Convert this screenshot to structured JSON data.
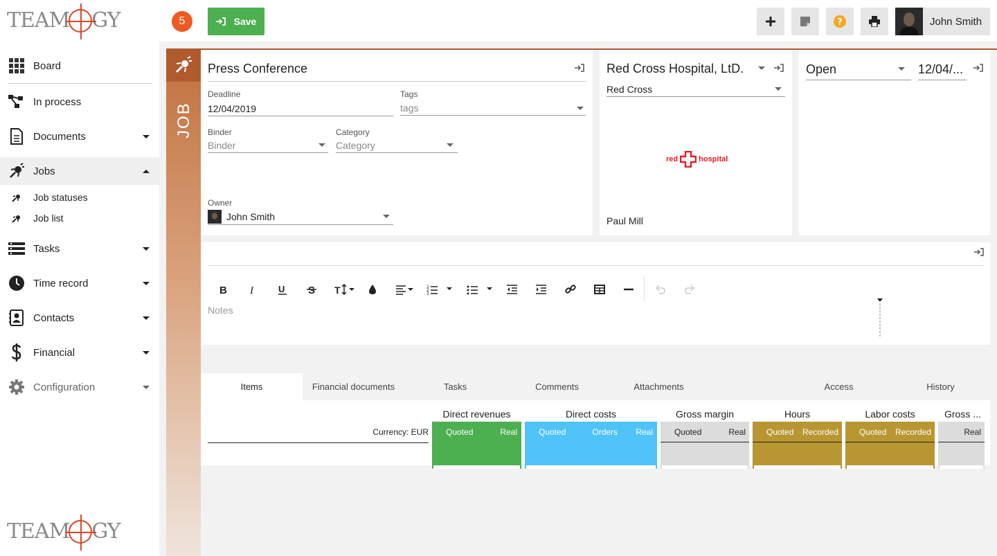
{
  "app": {
    "logo_text_left": "TEAM",
    "logo_text_right": "GY"
  },
  "sidebar": {
    "items": [
      {
        "label": "Board",
        "icon": "grid-icon"
      },
      {
        "label": "In process",
        "icon": "workflow-icon"
      },
      {
        "label": "Documents",
        "icon": "document-icon"
      },
      {
        "label": "Jobs",
        "icon": "rocket-icon"
      },
      {
        "label": "Job statuses",
        "icon": "rocket-icon"
      },
      {
        "label": "Job list",
        "icon": "rocket-icon"
      },
      {
        "label": "Tasks",
        "icon": "tasks-icon"
      },
      {
        "label": "Time record",
        "icon": "clock-icon"
      },
      {
        "label": "Contacts",
        "icon": "contacts-icon"
      },
      {
        "label": "Financial",
        "icon": "dollar-icon"
      },
      {
        "label": "Configuration",
        "icon": "gear-icon"
      }
    ]
  },
  "header": {
    "badge_count": "5",
    "save_label": "Save",
    "user_name": "John Smith"
  },
  "job": {
    "strip_label": "JOB",
    "title": "Press Conference",
    "deadline_label": "Deadline",
    "deadline_value": "12/04/2019",
    "tags_label": "Tags",
    "tags_placeholder": "tags",
    "binder_label": "Binder",
    "binder_placeholder": "Binder",
    "category_label": "Category",
    "category_placeholder": "Category",
    "owner_label": "Owner",
    "owner_value": "John Smith"
  },
  "client": {
    "company": "Red Cross Hospital, LtD.",
    "contact_group": "Red Cross",
    "logo_left": "red",
    "logo_right": "hospital",
    "person": "Paul Mill"
  },
  "status": {
    "value": "Open",
    "date": "12/04/..."
  },
  "notes": {
    "placeholder": "Notes"
  },
  "tabs": [
    "Items",
    "Financial documents",
    "Tasks",
    "Comments",
    "Attachments",
    "Access",
    "History"
  ],
  "items_grid": {
    "currency": "Currency: EUR",
    "groups": [
      {
        "title": "Direct revenues",
        "cols": [
          "Quoted",
          "Real"
        ],
        "color": "#4caf50"
      },
      {
        "title": "Direct costs",
        "cols": [
          "Quoted",
          "Orders",
          "Real"
        ],
        "color": "#4fc3f7"
      },
      {
        "title": "Gross margin",
        "cols": [
          "Quoted",
          "Real"
        ],
        "color": "#dcdcdc"
      },
      {
        "title": "Hours",
        "cols": [
          "Quoted",
          "Recorded"
        ],
        "color": "#b89632"
      },
      {
        "title": "Labor costs",
        "cols": [
          "Quoted",
          "Recorded"
        ],
        "color": "#b89632"
      },
      {
        "title": "Gross ...",
        "cols": [
          "Real"
        ],
        "color": "#dcdcdc"
      }
    ]
  }
}
